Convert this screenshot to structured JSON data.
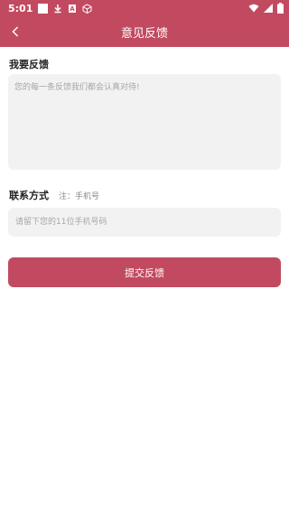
{
  "status_bar": {
    "time": "5:01",
    "icons": [
      "notification-square-icon",
      "download-icon",
      "a-box-icon",
      "cube-icon",
      "wifi-icon",
      "signal-icon",
      "battery-icon"
    ]
  },
  "toolbar": {
    "title": "意见反馈",
    "back_icon": "chevron-left-icon",
    "color": "#c24a60"
  },
  "feedback": {
    "label": "我要反馈",
    "placeholder": "您的每一条反馈我们都会认真对待!"
  },
  "contact": {
    "label": "联系方式",
    "note": "注：手机号",
    "placeholder": "请留下您的11位手机号码"
  },
  "submit": {
    "label": "提交反馈"
  },
  "colors": {
    "accent": "#c24a60",
    "input_bg": "#f2f2f2"
  }
}
